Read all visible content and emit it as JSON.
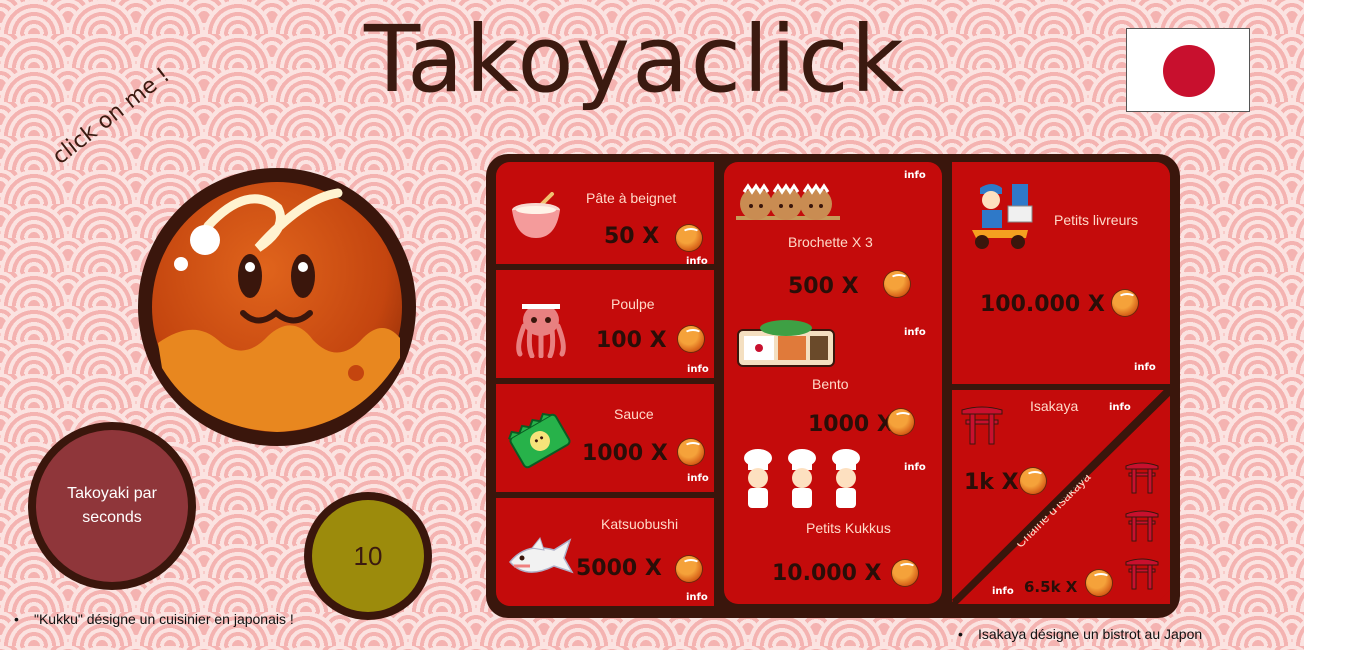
{
  "title": "Takoyaclick",
  "click_hint": "click on me !",
  "tps_label": "Takoyaki par seconds",
  "counter": "10",
  "notes": {
    "kukku": "\"Kukku\" désigne un cuisinier en japonais !",
    "isakaya": "Isakaya désigne un bistrot au Japon"
  },
  "info_label": "info",
  "upgrades": [
    {
      "name": "Pâte à beignet",
      "price": "50 X",
      "icon": "batter-bowl-icon"
    },
    {
      "name": "Poulpe",
      "price": "100 X",
      "icon": "octopus-icon"
    },
    {
      "name": "Sauce",
      "price": "1000 X",
      "icon": "sauce-packet-icon"
    },
    {
      "name": "Katsuobushi",
      "price": "5000 X",
      "icon": "shark-icon"
    },
    {
      "name": "Brochette X 3",
      "price": "500 X",
      "icon": "takoyaki-skewer-icon"
    },
    {
      "name": "Bento",
      "price": "1000 X",
      "icon": "bento-box-icon"
    },
    {
      "name": "Petits Kukkus",
      "price": "10.000 X",
      "icon": "chefs-icon"
    },
    {
      "name": "Petits livreurs",
      "price": "100.000 X",
      "icon": "delivery-scooter-icon"
    },
    {
      "name": "Isakaya",
      "price": "1k X",
      "icon": "torii-gate-icon"
    },
    {
      "name": "Chaîne d'Isakaya",
      "price": "6.5k X",
      "icon": "torii-gates-icon"
    }
  ],
  "colors": {
    "card_red": "#c40b0b",
    "frame_brown": "#3a160c",
    "flag_red": "#c8102e",
    "counter_olive": "#9c8b0c",
    "tps_maroon": "#8f363a"
  }
}
